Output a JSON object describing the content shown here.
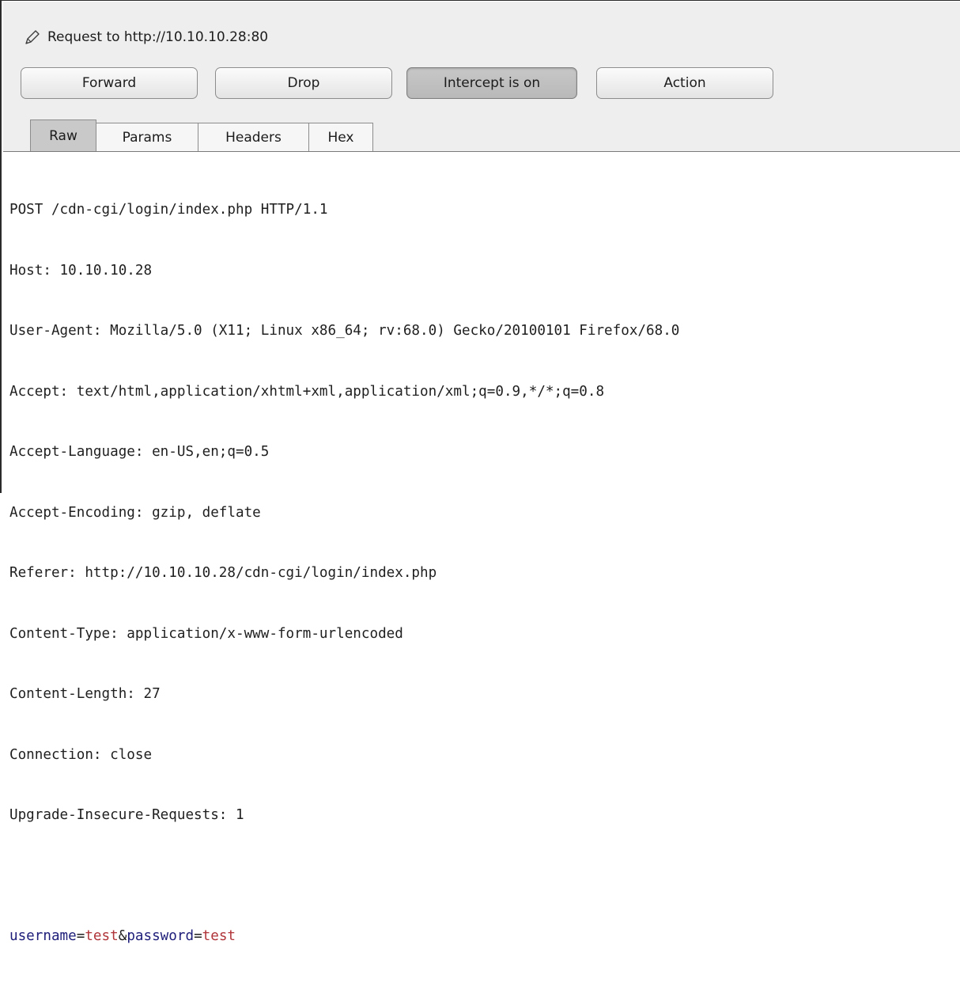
{
  "header": {
    "title": "Request to http://10.10.10.28:80",
    "edit_icon": "pencil-icon"
  },
  "buttons": {
    "forward": "Forward",
    "drop": "Drop",
    "intercept": "Intercept is on",
    "action": "Action"
  },
  "tabs": {
    "raw": "Raw",
    "params": "Params",
    "headers": "Headers",
    "hex": "Hex",
    "active": "Raw"
  },
  "request": {
    "lines": [
      "POST /cdn-cgi/login/index.php HTTP/1.1",
      "Host: 10.10.10.28",
      "User-Agent: Mozilla/5.0 (X11; Linux x86_64; rv:68.0) Gecko/20100101 Firefox/68.0",
      "Accept: text/html,application/xhtml+xml,application/xml;q=0.9,*/*;q=0.8",
      "Accept-Language: en-US,en;q=0.5",
      "Accept-Encoding: gzip, deflate",
      "Referer: http://10.10.10.28/cdn-cgi/login/index.php",
      "Content-Type: application/x-www-form-urlencoded",
      "Content-Length: 27",
      "Connection: close",
      "Upgrade-Insecure-Requests: 1"
    ],
    "body": {
      "param1_name": "username",
      "param1_value": "test",
      "separator": "&",
      "param2_name": "password",
      "param2_value": "test"
    }
  },
  "colors": {
    "param_name": "#1e1e7a",
    "param_value": "#b0353a",
    "active_tab": "#c9c9c9",
    "intercept_on": "#bdbdbd"
  }
}
